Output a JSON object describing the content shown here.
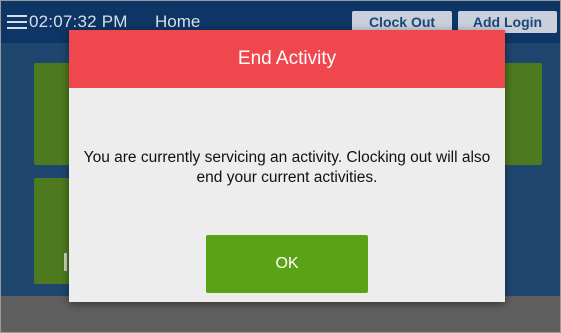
{
  "topbar": {
    "time": "02:07:32 PM",
    "title": "Home",
    "clock_out_label": "Clock Out",
    "add_login_label": "Add Login",
    "menu_icon": "hamburger-menu-icon"
  },
  "dialog": {
    "title": "End Activity",
    "message": "You are currently servicing an activity. Clocking out will also end your current activities.",
    "ok_label": "OK"
  },
  "colors": {
    "topbar_bg": "#0d3565",
    "tile_green": "#4d7a1e",
    "dialog_header": "#f0474e",
    "ok_button": "#5aa316",
    "topbar_button_bg": "#c9d0dc",
    "topbar_button_text": "#1c4677"
  }
}
